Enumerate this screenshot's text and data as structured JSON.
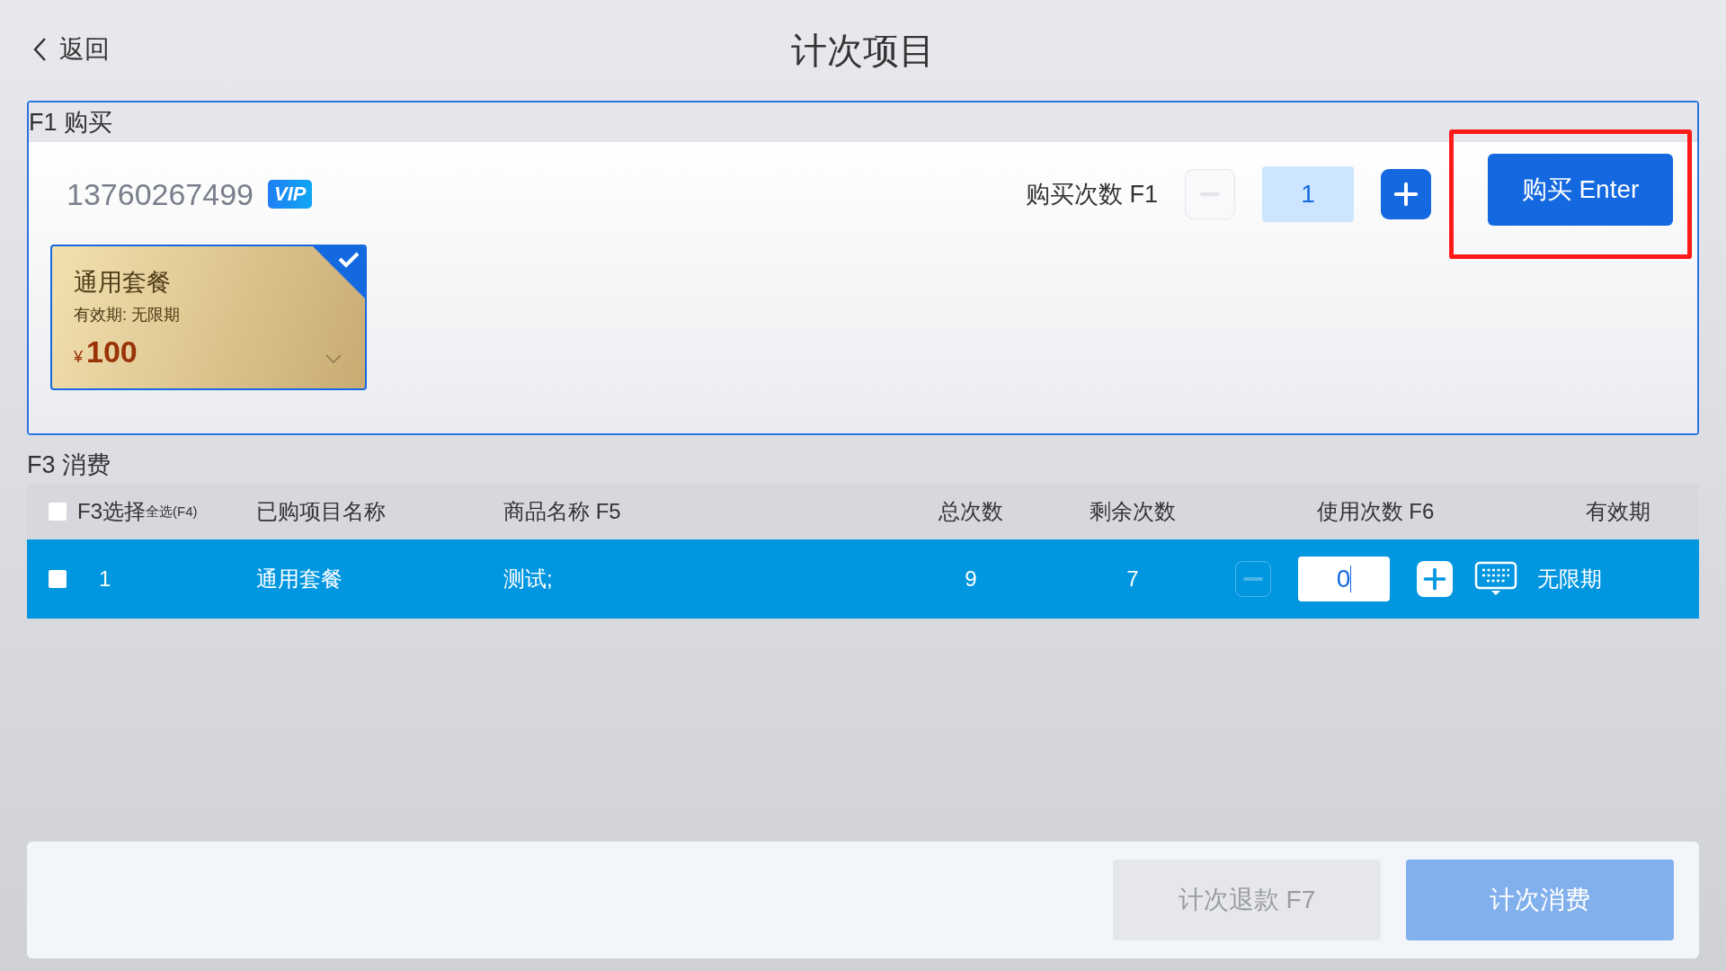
{
  "header": {
    "back": "返回",
    "title": "计次项目"
  },
  "purchase": {
    "section_title": "F1 购买",
    "phone": "13760267499",
    "badge": "VIP",
    "quantity_label": "购买次数 F1",
    "quantity": "1",
    "minus_disabled": true,
    "buy_button": "购买 Enter",
    "highlighted": true,
    "packages": [
      {
        "name": "通用套餐",
        "validity": "有效期: 无限期",
        "currency": "¥",
        "price": "100",
        "selected": true
      }
    ]
  },
  "consume": {
    "section_title": "F3 消费",
    "select_all": {
      "label": "F3选择",
      "hint": "全选(F4)",
      "checked": false
    },
    "columns": [
      "已购项目名称",
      "商品名称 F5",
      "总次数",
      "剩余次数",
      "使用次数 F6",
      "有效期"
    ],
    "rows": [
      {
        "checked": false,
        "selected": true,
        "index": "1",
        "name": "通用套餐",
        "product": "测试;",
        "total": "9",
        "remaining": "7",
        "use_count": "0",
        "minus_disabled": true,
        "validity": "无限期"
      }
    ]
  },
  "footer": {
    "buttons": [
      {
        "label": "计次退款 F7",
        "kind": "refund",
        "disabled": true
      },
      {
        "label": "计次消费",
        "kind": "consume",
        "disabled": true
      }
    ]
  }
}
